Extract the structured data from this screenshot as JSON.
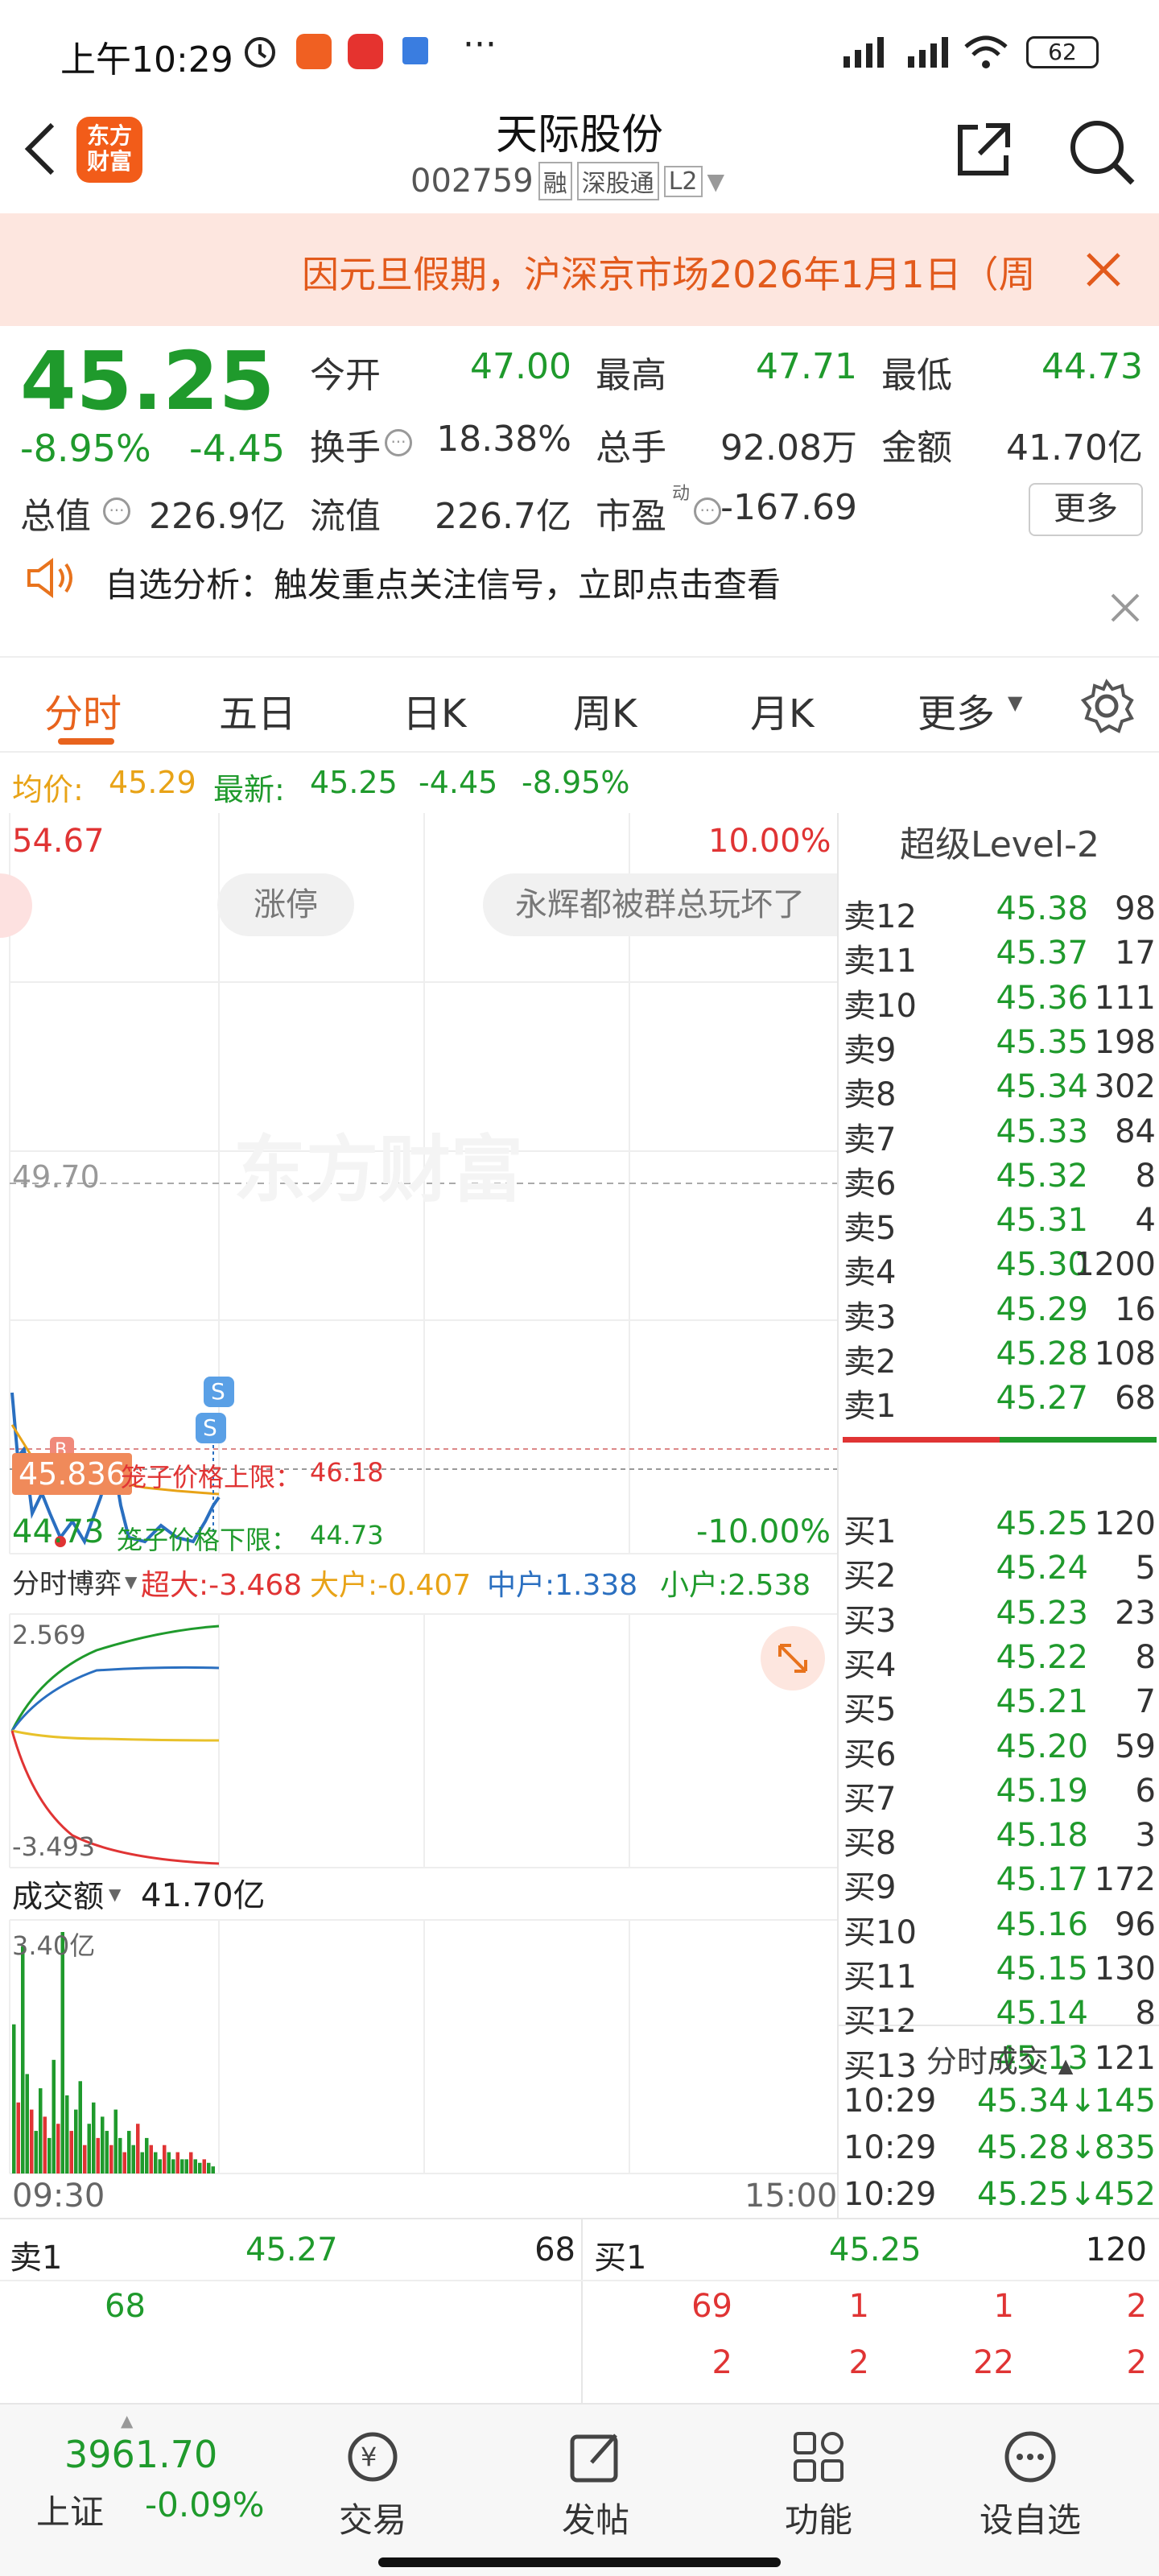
{
  "status": {
    "time": "上午10:29",
    "battery": "62",
    "more": "···"
  },
  "header": {
    "title": "天际股份",
    "code": "002759",
    "tag1": "融",
    "tag2": "深股通",
    "tag3": "L2",
    "logo_line1": "东方",
    "logo_line2": "财富"
  },
  "banner": {
    "text": "因元旦假期，沪深京市场2026年1月1日（周"
  },
  "quote": {
    "price": "45.25",
    "pct": "-8.95%",
    "chg": "-4.45",
    "open_label": "今开",
    "open": "47.00",
    "high_label": "最高",
    "high": "47.71",
    "low_label": "最低",
    "low": "44.73",
    "turnover_label": "换手",
    "turnover": "18.38%",
    "vol_label": "总手",
    "vol": "92.08万",
    "amt_label": "金额",
    "amt": "41.70亿",
    "mcap_label": "总值",
    "mcap": "226.9亿",
    "float_label": "流值",
    "float": "226.7亿",
    "pe_label": "市盈",
    "pe_sup": "动",
    "pe": "-167.69",
    "more": "更多"
  },
  "alert": {
    "text": "自选分析：触发重点关注信号，立即点击查看"
  },
  "tabs": [
    "分时",
    "五日",
    "日K",
    "周K",
    "月K",
    "更多"
  ],
  "avgline": {
    "avg_label": "均价:",
    "avg": "45.29",
    "last_label": "最新:",
    "last": "45.25",
    "chg": "-4.45",
    "pct": "-8.95%"
  },
  "chart": {
    "top_price": "54.67",
    "top_pct": "10.00%",
    "pill1": "涨停",
    "pill2": "永辉都被群总玩坏了",
    "watermark": "东方财富",
    "mid_price": "49.70",
    "bottom_price": "44.73",
    "bottom_pct": "-10.00%",
    "cur_price": "45.836",
    "upper_label": "笼子价格上限：",
    "upper": "46.18",
    "lower_label": "笼子价格下限：",
    "lower": "44.73",
    "flow_label": "分时博弈",
    "flow_super": "超大:-3.468",
    "flow_big": "大户:-0.407",
    "flow_mid": "中户:1.338",
    "flow_small": "小户:2.538",
    "flow_max": "2.569",
    "flow_min": "-3.493",
    "vol_label": "成交额",
    "vol_total": "41.70亿",
    "vol_max": "3.40亿",
    "t_start": "09:30",
    "t_end": "15:00"
  },
  "chart_data": {
    "type": "bar",
    "title": "成交额",
    "ylim": [
      0,
      3.4
    ],
    "values": [
      2.1,
      1.0,
      3.2,
      1.4,
      0.9,
      0.6,
      1.2,
      0.8,
      0.5,
      1.6,
      0.7,
      3.4,
      1.1,
      0.6,
      0.9,
      1.3,
      0.4,
      0.7,
      1.0,
      0.5,
      0.8,
      0.6,
      0.4,
      0.9,
      0.5,
      0.3,
      0.6,
      0.4,
      0.7,
      0.3,
      0.5,
      0.4,
      0.3,
      0.2,
      0.4,
      0.3,
      0.2,
      0.3,
      0.2,
      0.2,
      0.3,
      0.2,
      0.15,
      0.2,
      0.15,
      0.1
    ]
  },
  "book": {
    "title": "超级Level-2",
    "asks": [
      [
        "卖12",
        "45.38",
        "98"
      ],
      [
        "卖11",
        "45.37",
        "17"
      ],
      [
        "卖10",
        "45.36",
        "111"
      ],
      [
        "卖9",
        "45.35",
        "198"
      ],
      [
        "卖8",
        "45.34",
        "302"
      ],
      [
        "卖7",
        "45.33",
        "84"
      ],
      [
        "卖6",
        "45.32",
        "8"
      ],
      [
        "卖5",
        "45.31",
        "4"
      ],
      [
        "卖4",
        "45.30",
        "1200"
      ],
      [
        "卖3",
        "45.29",
        "16"
      ],
      [
        "卖2",
        "45.28",
        "108"
      ],
      [
        "卖1",
        "45.27",
        "68"
      ]
    ],
    "bids": [
      [
        "买1",
        "45.25",
        "120"
      ],
      [
        "买2",
        "45.24",
        "5"
      ],
      [
        "买3",
        "45.23",
        "23"
      ],
      [
        "买4",
        "45.22",
        "8"
      ],
      [
        "买5",
        "45.21",
        "7"
      ],
      [
        "买6",
        "45.20",
        "59"
      ],
      [
        "买7",
        "45.19",
        "6"
      ],
      [
        "买8",
        "45.18",
        "3"
      ],
      [
        "买9",
        "45.17",
        "172"
      ],
      [
        "买10",
        "45.16",
        "96"
      ],
      [
        "买11",
        "45.15",
        "130"
      ],
      [
        "买12",
        "45.14",
        "8"
      ],
      [
        "买13",
        "45.13",
        "121"
      ]
    ],
    "ticks_label": "分时成交",
    "ticks": [
      [
        "10:29",
        "45.34↓",
        "145"
      ],
      [
        "10:29",
        "45.28↓",
        "835"
      ],
      [
        "10:29",
        "45.25↓",
        "452"
      ]
    ]
  },
  "queue": {
    "ask_label": "卖1",
    "ask_price": "45.27",
    "ask_vol": "68",
    "ask_q": [
      "68"
    ],
    "bid_label": "买1",
    "bid_price": "45.25",
    "bid_vol": "120",
    "bid_q1": [
      "69",
      "1",
      "1",
      "2"
    ],
    "bid_q2": [
      "2",
      "2",
      "22",
      "2"
    ]
  },
  "nav": {
    "index_value": "3961.70",
    "index_name": "上证",
    "index_pct": "-0.09%",
    "items": [
      "交易",
      "发帖",
      "功能",
      "设自选"
    ]
  }
}
